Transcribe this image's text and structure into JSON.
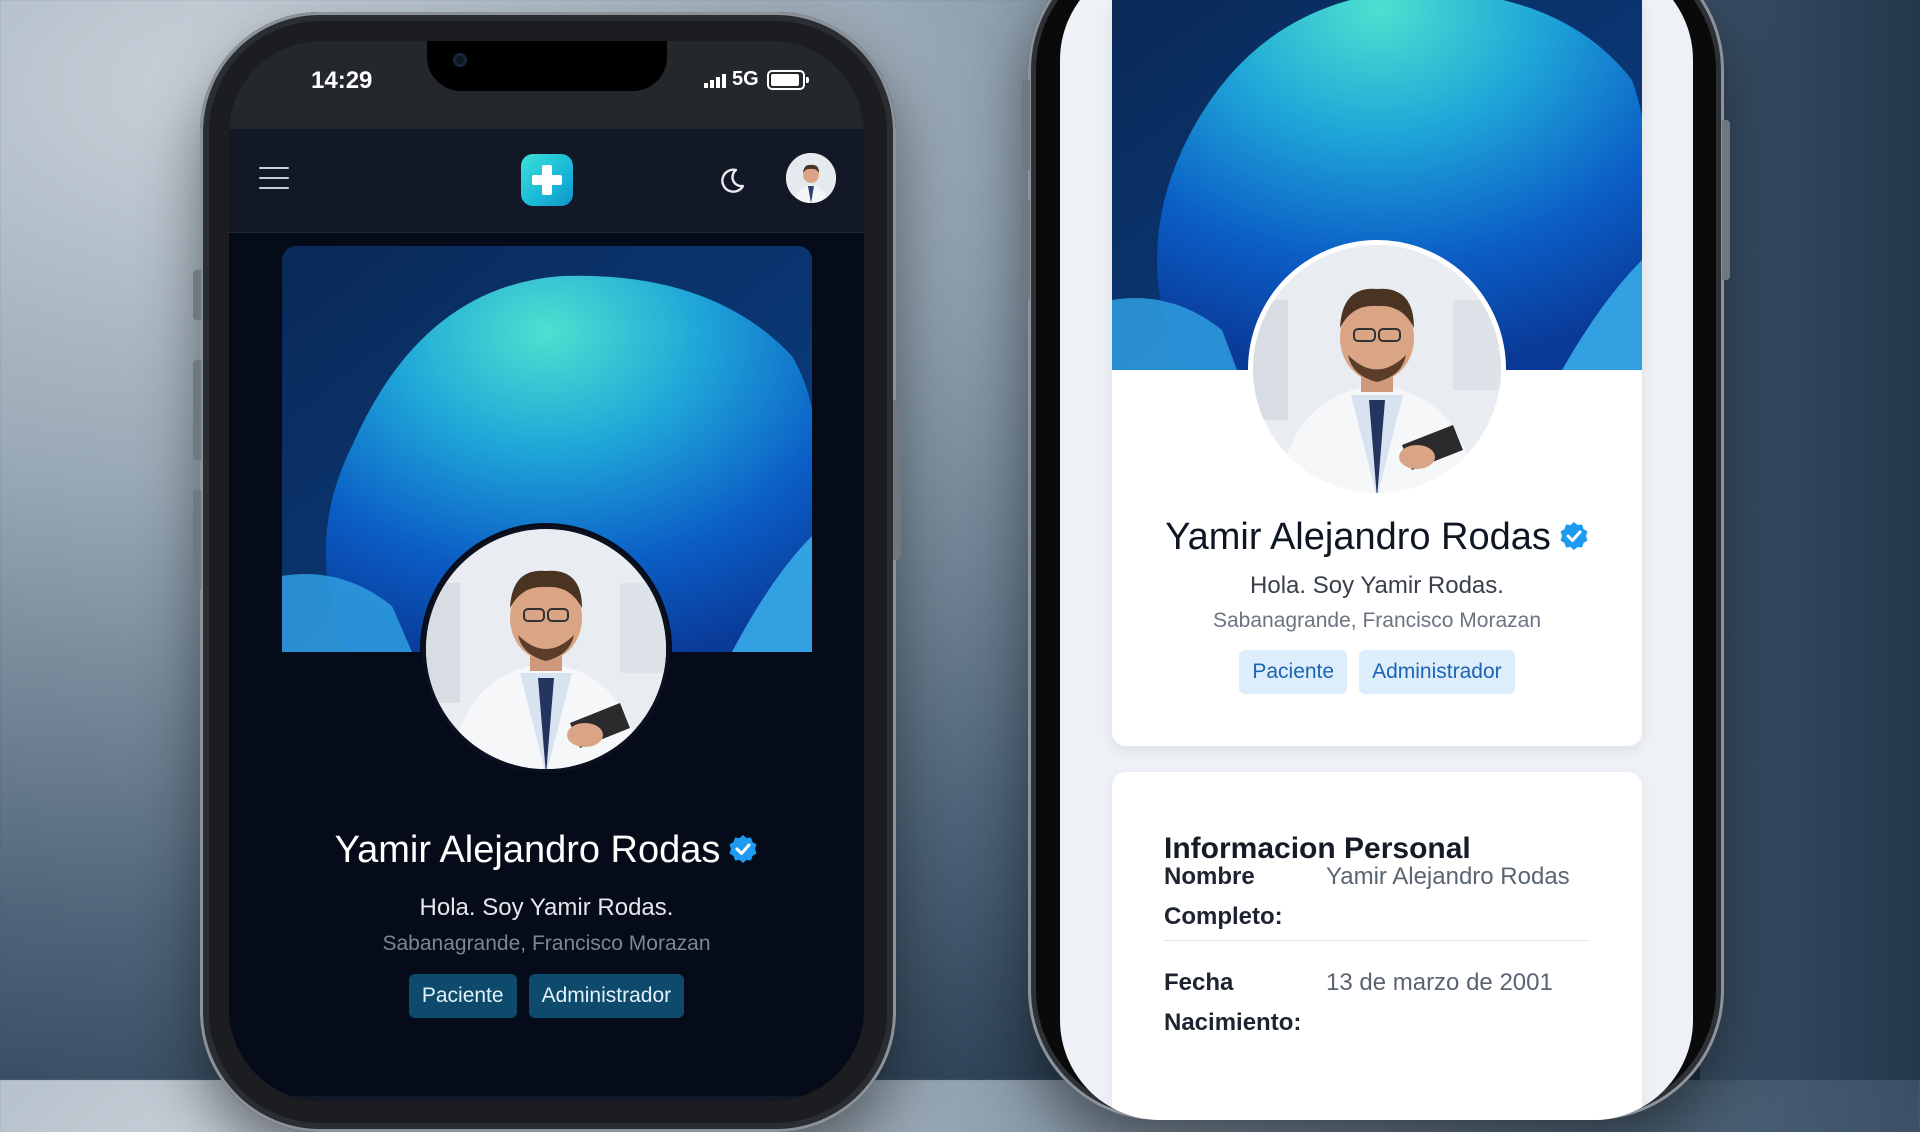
{
  "status_bar": {
    "time": "14:29",
    "network": "5G"
  },
  "nav": {
    "logo": "plus-logo",
    "theme_icon": "moon-icon"
  },
  "profile": {
    "name": "Yamir Alejandro Rodas",
    "bio": "Hola. Soy Yamir Rodas.",
    "location": "Sabanagrande, Francisco Morazan",
    "roles": [
      "Paciente",
      "Administrador"
    ],
    "verified": true
  },
  "personal_info": {
    "title": "Informacion Personal",
    "rows": [
      {
        "label": "Nombre Completo:",
        "value": "Yamir Alejandro Rodas"
      },
      {
        "label": "Fecha Nacimiento:",
        "value": "13 de marzo de 2001"
      }
    ]
  },
  "colors": {
    "accent": "#1d9bf0",
    "dark_bg": "#050b18",
    "tag_dark": "#0e4a6b",
    "tag_light": "#deedfb"
  }
}
